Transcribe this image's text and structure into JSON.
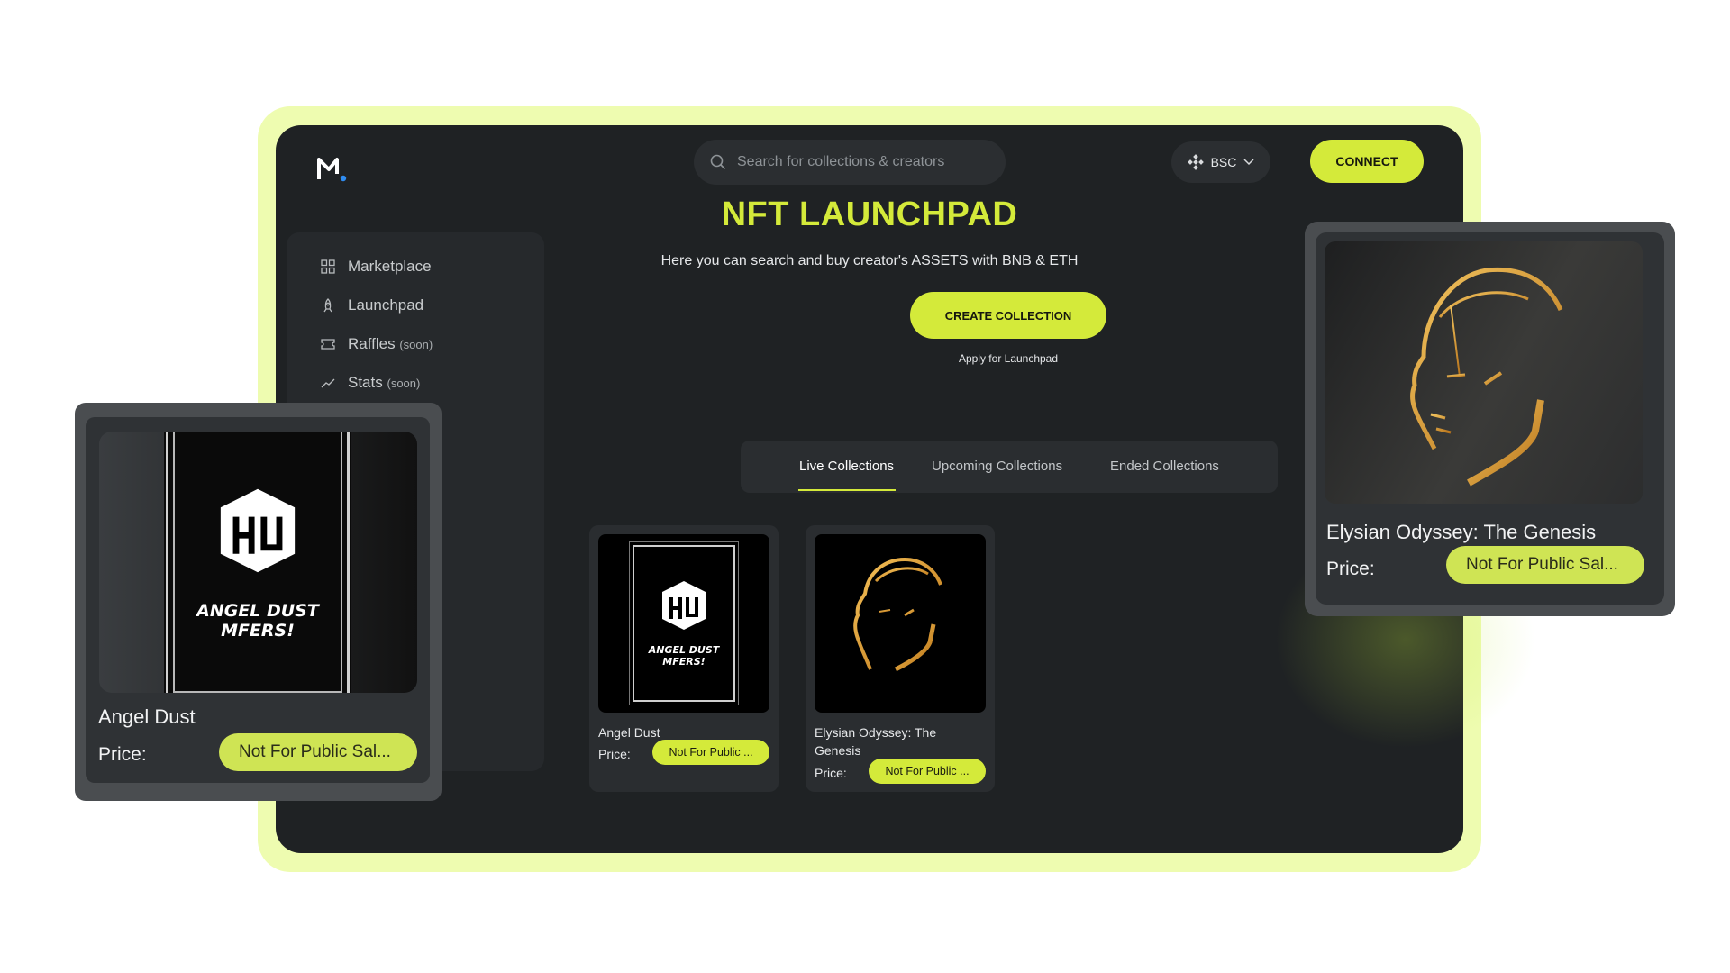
{
  "header": {
    "search_placeholder": "Search for collections & creators",
    "chain_label": "BSC",
    "connect_label": "CONNECT"
  },
  "hero": {
    "title": "NFT LAUNCHPAD",
    "subtitle": "Here you can search and buy creator's ASSETS with BNB & ETH",
    "create_label": "CREATE COLLECTION",
    "apply_label": "Apply for Launchpad"
  },
  "sidebar": {
    "items": [
      {
        "label": "Marketplace",
        "tag": "",
        "icon": "grid-icon"
      },
      {
        "label": "Launchpad",
        "tag": "",
        "icon": "rocket-icon"
      },
      {
        "label": "Raffles",
        "tag": "(soon)",
        "icon": "ticket-icon"
      },
      {
        "label": "Stats",
        "tag": "(soon)",
        "icon": "trend-icon"
      }
    ]
  },
  "tabs": [
    {
      "label": "Live Collections",
      "active": true
    },
    {
      "label": "Upcoming Collections",
      "active": false
    },
    {
      "label": "Ended Collections",
      "active": false
    }
  ],
  "cards": [
    {
      "name": "Angel Dust",
      "price_label": "Price:",
      "price_value": "Not For Public ...",
      "art_text_1": "ANGEL DUST",
      "art_text_2": "MFERS!"
    },
    {
      "name": "Elysian Odyssey: The Genesis",
      "price_label": "Price:",
      "price_value": "Not For Public ..."
    }
  ],
  "float_left": {
    "name": "Angel Dust",
    "price_label": "Price:",
    "price_value": "Not For Public Sal...",
    "art_text_1": "ANGEL DUST",
    "art_text_2": "MFERS!"
  },
  "float_right": {
    "name": "Elysian Odyssey: The Genesis",
    "price_label": "Price:",
    "price_value": "Not For Public Sal..."
  },
  "colors": {
    "accent": "#d4ea3a",
    "app_bg": "#1f2224",
    "frame": "#eefcb0"
  }
}
